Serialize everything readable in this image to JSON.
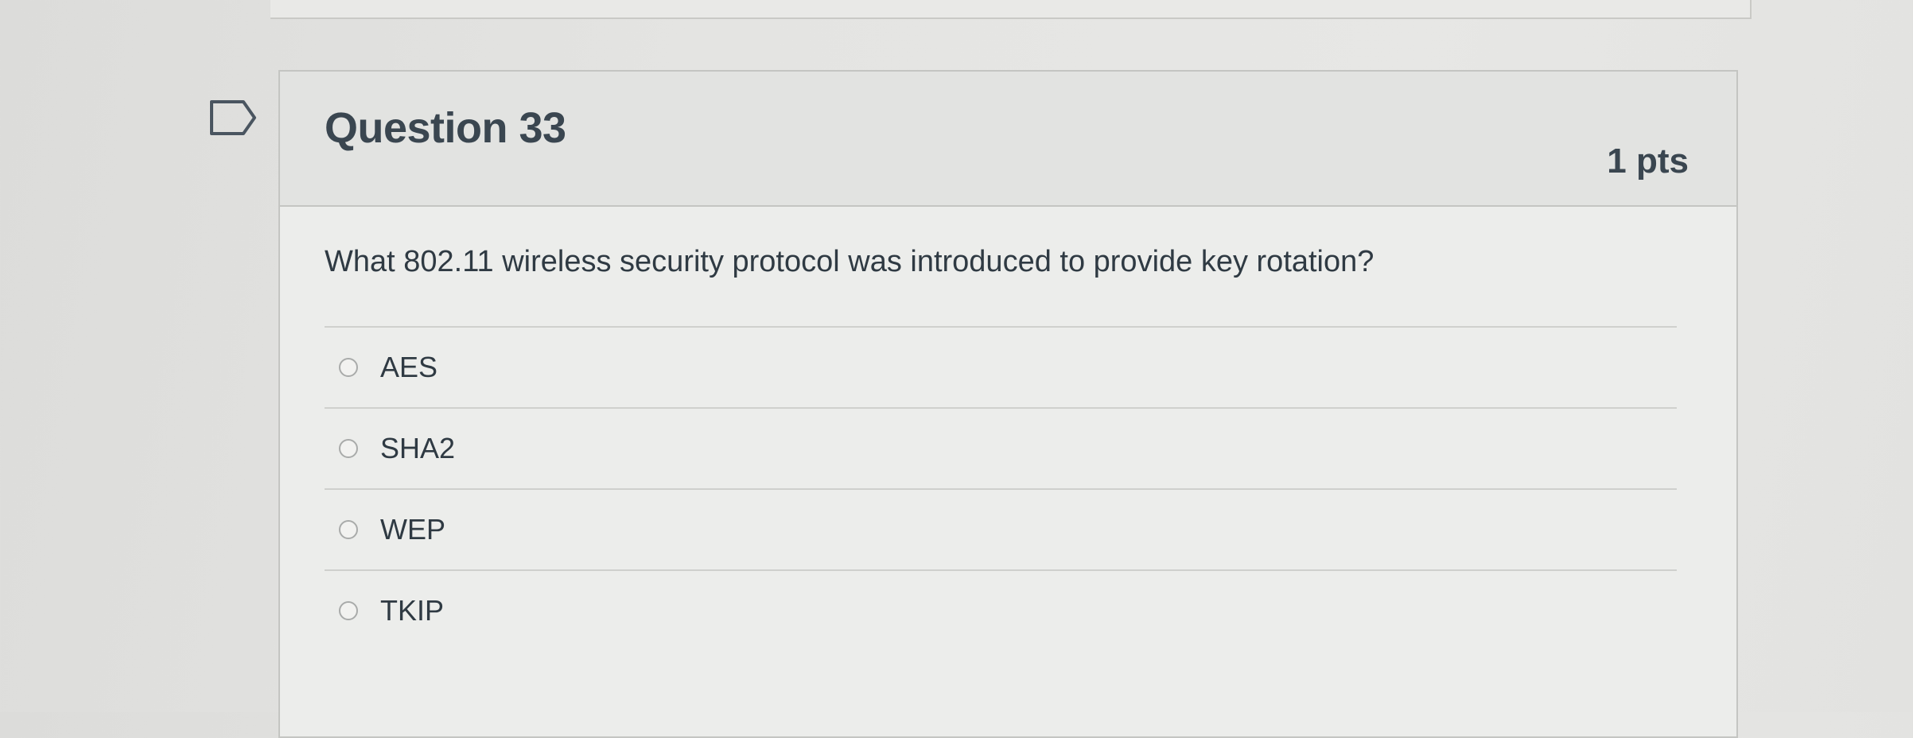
{
  "question": {
    "title": "Question 33",
    "points": "1 pts",
    "text": "What 802.11 wireless security protocol was introduced to provide key rotation?",
    "flag_icon": "flag-outline-icon",
    "answers": [
      {
        "label": "AES"
      },
      {
        "label": "SHA2"
      },
      {
        "label": "WEP"
      },
      {
        "label": "TKIP"
      }
    ]
  },
  "colors": {
    "text": "#2d3b45",
    "header_bg": "#e2e3e1",
    "border": "#c4c5c2"
  }
}
